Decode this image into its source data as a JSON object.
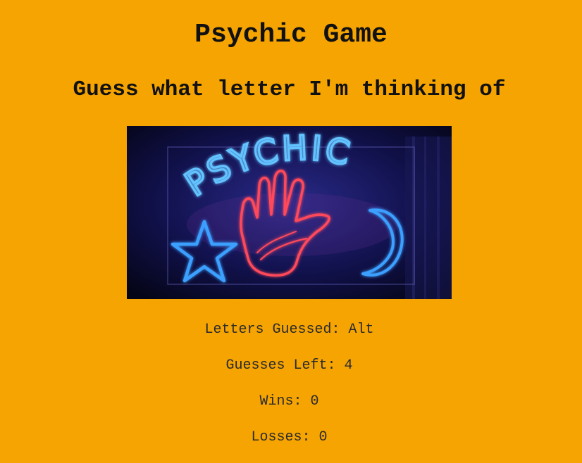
{
  "page": {
    "title": "Psychic Game",
    "subtitle": "Guess what letter I'm thinking of"
  },
  "image": {
    "sign_text": "PSYCHIC",
    "icons": [
      "star-icon",
      "hand-icon",
      "moon-icon"
    ],
    "colors": {
      "neon_blue": "#3aa0ff",
      "neon_red": "#ff4a5a",
      "background": "#0a0a2e"
    }
  },
  "stats": {
    "letters_guessed": "Letters Guessed: Alt",
    "guesses_left": "Guesses Left: 4",
    "wins": "Wins: 0",
    "losses": "Losses: 0"
  },
  "colors": {
    "page_background": "#f5a402",
    "text": "#111111"
  }
}
